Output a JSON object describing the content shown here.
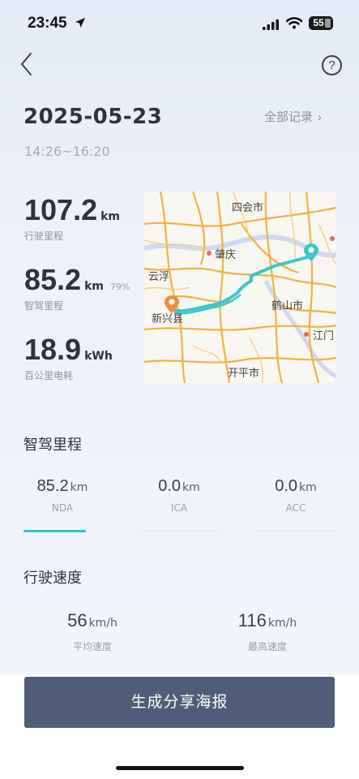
{
  "status_bar": {
    "time": "23:45",
    "battery": "55"
  },
  "header": {
    "date": "2025-05-23",
    "all_records_label": "全部记录",
    "time_range": "14:26~16:20"
  },
  "stats": {
    "driving": {
      "value": "107.2",
      "unit": "km",
      "label": "行驶里程"
    },
    "smart": {
      "value": "85.2",
      "unit": "km",
      "percent": "79%",
      "label": "智驾里程"
    },
    "energy": {
      "value": "18.9",
      "unit": "kWh",
      "label": "百公里电耗"
    }
  },
  "map": {
    "labels": {
      "sihui": "四会市",
      "zhaoqing": "肇庆",
      "yunfu": "云浮",
      "xinxing": "新兴县",
      "heshan": "鹤山市",
      "jiangmen": "江门",
      "kaiping": "开平市"
    },
    "route_color": "#3cc6c8",
    "start_color": "#f08c3a",
    "road_color": "#f2b240"
  },
  "smart_section": {
    "title": "智驾里程",
    "tabs": [
      {
        "value": "85.2",
        "unit": "km",
        "label": "NDA"
      },
      {
        "value": "0.0",
        "unit": "km",
        "label": "ICA"
      },
      {
        "value": "0.0",
        "unit": "km",
        "label": "ACC"
      }
    ],
    "accent": "#2cc3c9"
  },
  "speed_section": {
    "title": "行驶速度",
    "avg": {
      "value": "56",
      "unit": "km/h",
      "label": "平均速度"
    },
    "max": {
      "value": "116",
      "unit": "km/h",
      "label": "最高速度"
    }
  },
  "cta": {
    "label": "生成分享海报",
    "color": "#4f5d7a"
  }
}
